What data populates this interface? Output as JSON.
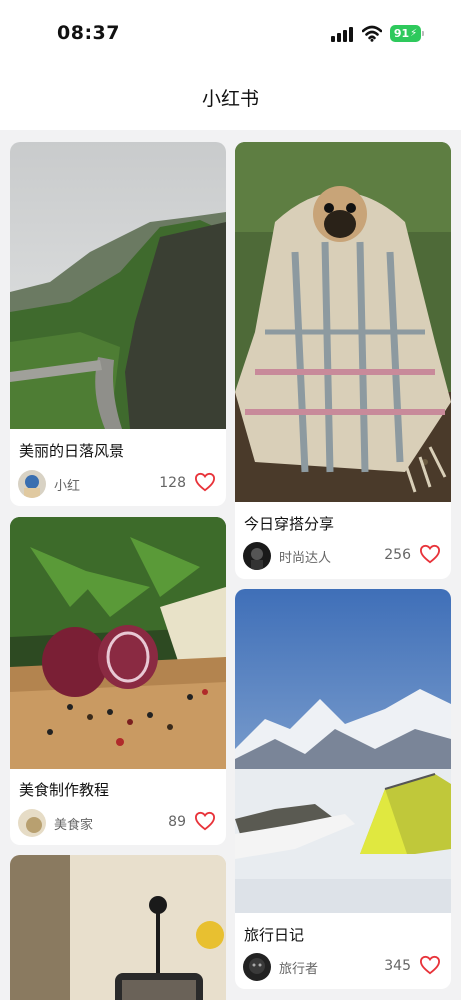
{
  "status_bar": {
    "time": "08:37",
    "battery": "91",
    "icons": [
      "signal-icon",
      "wifi-icon",
      "battery-icon"
    ],
    "battery_color": "#2ec95c"
  },
  "header": {
    "title": "小红书"
  },
  "accent_color": "#e8333a",
  "feed": {
    "left": [
      {
        "title": "美丽的日落风景",
        "author": "小红",
        "likes": "128",
        "image": "mountain-landscape-photo"
      },
      {
        "title": "美食制作教程",
        "author": "美食家",
        "likes": "89",
        "image": "onions-and-peppercorns-photo"
      },
      {
        "title": "",
        "author": "",
        "likes": "",
        "image": "french-press-photo"
      }
    ],
    "right": [
      {
        "title": "今日穿搭分享",
        "author": "时尚达人",
        "likes": "256",
        "image": "pug-in-blanket-photo"
      },
      {
        "title": "旅行日记",
        "author": "旅行者",
        "likes": "345",
        "image": "snowy-mountain-tent-photo"
      }
    ]
  }
}
